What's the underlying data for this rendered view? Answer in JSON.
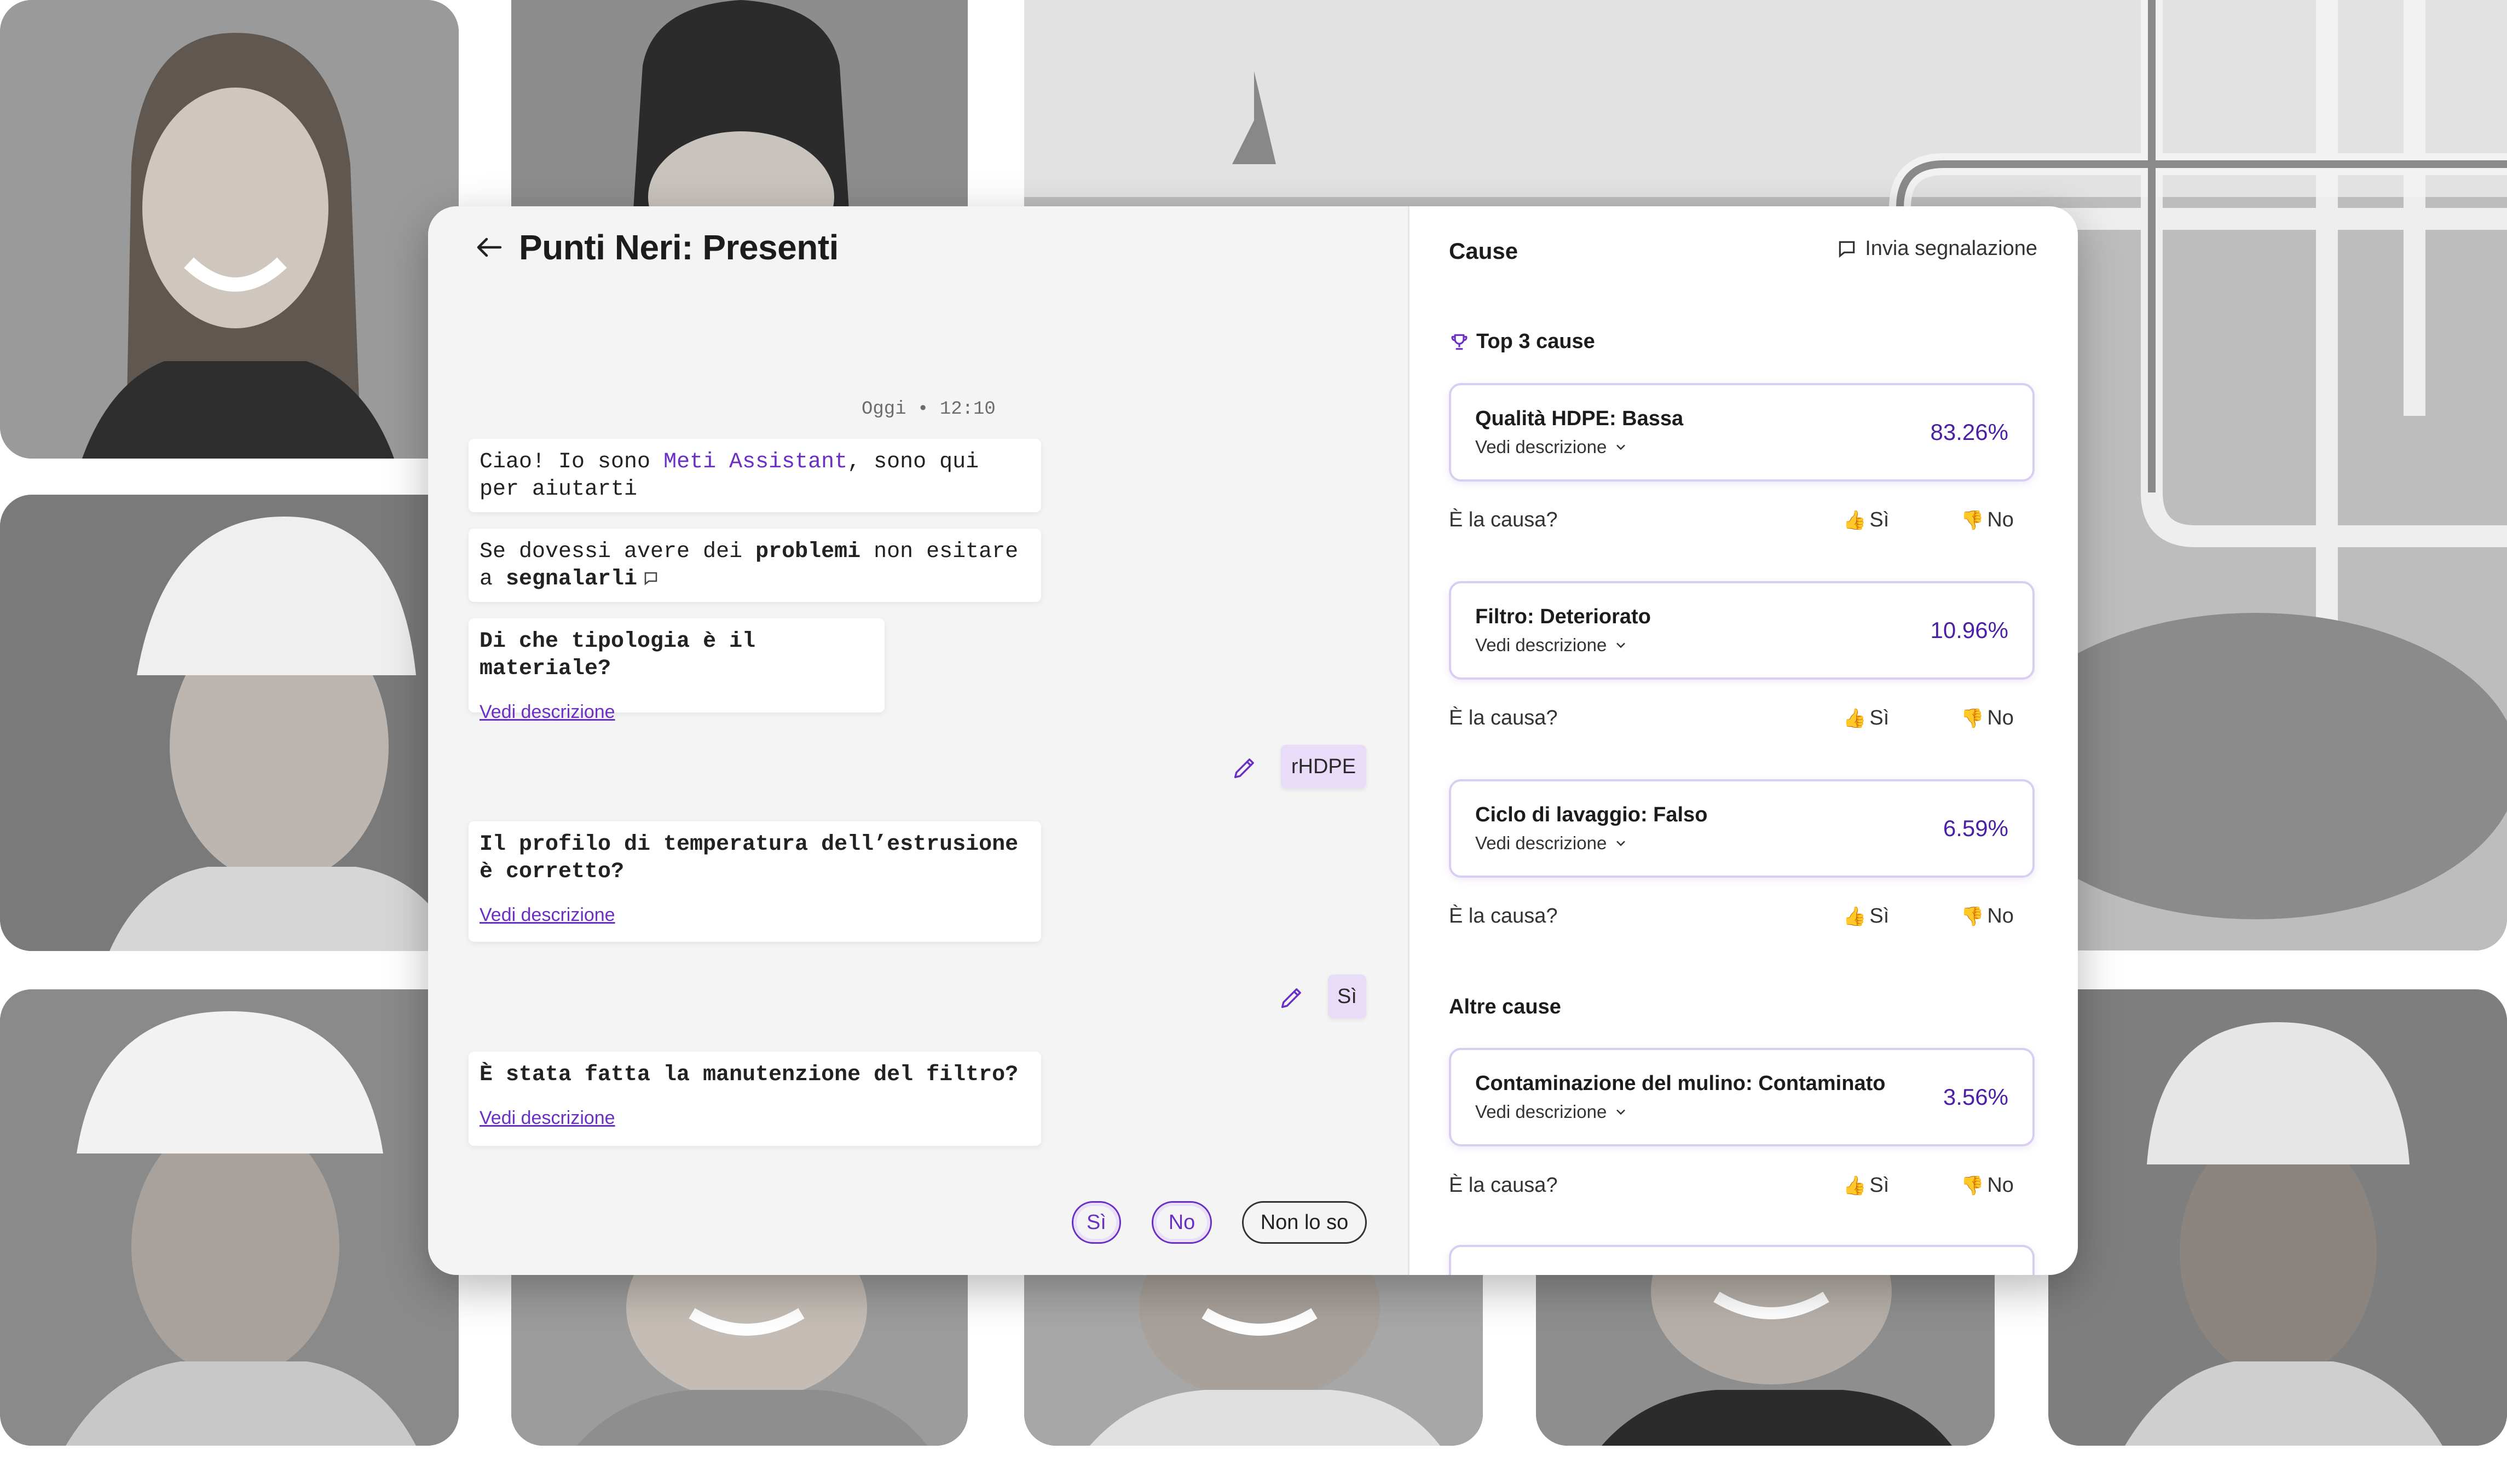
{
  "chat": {
    "title": "Punti Neri: Presenti",
    "timestamp": "Oggi • 12:10",
    "messages": [
      {
        "text_before": "Ciao! Io sono ",
        "accent": "Meti Assistant",
        "text_after": ", sono qui per aiutarti"
      },
      {
        "text_before": "Se dovessi avere dei ",
        "bold": "problemi",
        "text_middle": " non esitare a ",
        "bold2": "segnalarli"
      },
      {
        "question": "Di che tipologia è il materiale?",
        "link": "Vedi descrizione"
      },
      {
        "question": "Il profilo di temperatura dell’estrusione è corretto?",
        "link": "Vedi descrizione"
      },
      {
        "question": "È stata fatta la manutenzione del filtro?",
        "link": "Vedi descrizione"
      }
    ],
    "replies": [
      "rHDPE",
      "Sì"
    ],
    "options": [
      "Sì",
      "No",
      "Non lo so"
    ]
  },
  "panel": {
    "title": "Cause",
    "report_label": "Invia segnalazione",
    "top_label": "Top 3 cause",
    "other_label": "Altre cause",
    "ask_label": "È la causa?",
    "yes_label": "Sì",
    "no_label": "No",
    "causes": [
      {
        "name": "Qualità HDPE: Bassa",
        "desc": "Vedi descrizione",
        "pct": "83.26%"
      },
      {
        "name": "Filtro: Deteriorato",
        "desc": "Vedi descrizione",
        "pct": "10.96%"
      },
      {
        "name": "Ciclo di lavaggio: Falso",
        "desc": "Vedi descrizione",
        "pct": "6.59%"
      },
      {
        "name": "Contaminazione del mulino: Contaminato",
        "desc": "Vedi descrizione",
        "pct": "3.56%"
      }
    ]
  },
  "colors": {
    "accent": "#6a2fc4",
    "accent_light": "#e8dcf8",
    "card_border": "#d9cdf1",
    "pct": "#4b1fa6"
  },
  "icons": [
    "arrow-left-icon",
    "edit-pencil-icon",
    "chat-bubble-icon",
    "trophy-icon",
    "chevron-down-icon",
    "thumbs-up-icon",
    "thumbs-down-icon"
  ]
}
